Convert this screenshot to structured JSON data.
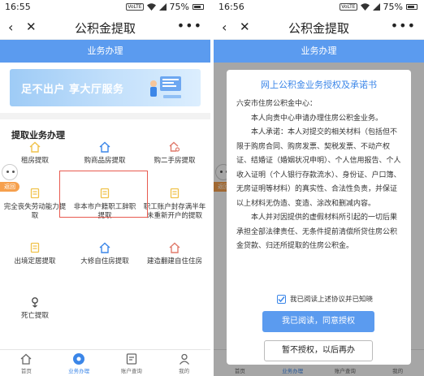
{
  "left": {
    "status": {
      "time": "16:55",
      "battery": "75%",
      "net_badge": "VoLTE"
    },
    "nav": {
      "title": "公积金提取",
      "back": "‹",
      "close": "✕",
      "more": "•••"
    },
    "section_bar": "业务办理",
    "banner": {
      "text": "足不出户 享大厅服务"
    },
    "list_title": "提取业务办理",
    "float_tag": "返回",
    "items": [
      {
        "label": "租房提取",
        "icon": "house-icon"
      },
      {
        "label": "购商品房提取",
        "icon": "house-icon"
      },
      {
        "label": "购二手房提取",
        "icon": "house-key-icon"
      },
      {
        "label": "完全丧失劳动能力提取",
        "icon": "document-icon"
      },
      {
        "label": "非本市户籍职工辞职提取",
        "icon": "document-icon",
        "highlighted": true
      },
      {
        "label": "职工账户封存满半年未重新开户的提取",
        "icon": "document-icon"
      },
      {
        "label": "出境定居提取",
        "icon": "document-icon"
      },
      {
        "label": "大修自住房提取",
        "icon": "house-icon"
      },
      {
        "label": "建造翻建自住住房",
        "icon": "house-icon"
      },
      {
        "label": "死亡提取",
        "icon": "flower-icon"
      }
    ],
    "tabs": [
      {
        "label": "首页",
        "icon": "home-icon",
        "active": false
      },
      {
        "label": "业务办理",
        "icon": "service-icon",
        "active": true
      },
      {
        "label": "账户查询",
        "icon": "account-icon",
        "active": false
      },
      {
        "label": "我的",
        "icon": "user-icon",
        "active": false
      }
    ]
  },
  "right": {
    "status": {
      "time": "16:56",
      "battery": "75%",
      "net_badge": "VoLTE"
    },
    "nav": {
      "title": "公积金提取",
      "back": "‹",
      "close": "✕",
      "more": "•••"
    },
    "section_bar": "业务办理",
    "float_tag": "返回",
    "modal": {
      "title": "网上公积金业务授权及承诺书",
      "addressee": "六安市住房公积金中心：",
      "para1": "本人向贵中心申请办理住房公积金业务。",
      "para2": "本人承诺：本人对提交的相关材料（包括但不限于购房合同、购房发票、契税发票、不动产权证、结婚证（婚姻状况申明）、个人信用报告、个人收入证明（个人银行存款流水）、身份证、户口簿、无房证明等材料）的真实性、合法性负责，并保证以上材料无伪造、变造、涂改和删减内容。",
      "para3": "本人并对因提供的虚假材料所引起的一切后果承担全部法律责任、无条件提前清偿所贷住房公积金贷款、归还所提取的住房公积金。",
      "consent": "我已阅读上述协议并已知晓",
      "consent_checked": true,
      "agree_button": "我已阅读，同意授权",
      "deny_button": "暂不授权，以后再办"
    },
    "tabs": [
      {
        "label": "首页"
      },
      {
        "label": "业务办理"
      },
      {
        "label": "账户查询"
      },
      {
        "label": "我的"
      }
    ]
  },
  "colors": {
    "primary": "#5b9bef",
    "accent_text": "#3b86e8",
    "highlight": "#e85a4f",
    "float": "#f6a04d",
    "icon_yellow": "#f0c24b",
    "icon_blue": "#3b86e8",
    "icon_red": "#e07a6b"
  }
}
